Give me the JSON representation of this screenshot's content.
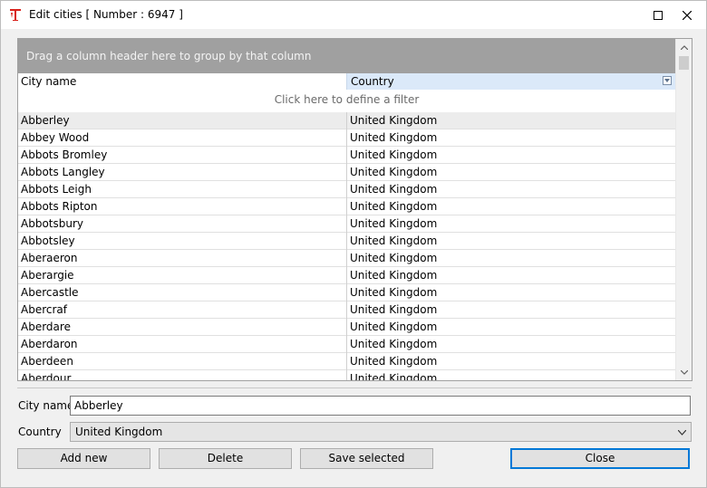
{
  "window": {
    "title": "Edit cities [ Number : 6947 ]"
  },
  "grid": {
    "group_hint": "Drag a column header here to group by that column",
    "columns": [
      "City name",
      "Country"
    ],
    "filter_hint": "Click here to define a filter",
    "rows": [
      {
        "city": "Abberley",
        "country": "United Kingdom"
      },
      {
        "city": "Abbey Wood",
        "country": "United Kingdom"
      },
      {
        "city": "Abbots Bromley",
        "country": "United Kingdom"
      },
      {
        "city": "Abbots Langley",
        "country": "United Kingdom"
      },
      {
        "city": "Abbots Leigh",
        "country": "United Kingdom"
      },
      {
        "city": "Abbots Ripton",
        "country": "United Kingdom"
      },
      {
        "city": "Abbotsbury",
        "country": "United Kingdom"
      },
      {
        "city": "Abbotsley",
        "country": "United Kingdom"
      },
      {
        "city": "Aberaeron",
        "country": "United Kingdom"
      },
      {
        "city": "Aberargie",
        "country": "United Kingdom"
      },
      {
        "city": "Abercastle",
        "country": "United Kingdom"
      },
      {
        "city": "Abercraf",
        "country": "United Kingdom"
      },
      {
        "city": "Aberdare",
        "country": "United Kingdom"
      },
      {
        "city": "Aberdaron",
        "country": "United Kingdom"
      },
      {
        "city": "Aberdeen",
        "country": "United Kingdom"
      },
      {
        "city": "Aberdour",
        "country": "United Kingdom"
      }
    ]
  },
  "form": {
    "city_label": "City name",
    "city_value": "Abberley",
    "country_label": "Country",
    "country_value": "United Kingdom"
  },
  "buttons": {
    "add_new": "Add new",
    "delete": "Delete",
    "save_selected": "Save selected",
    "close": "Close"
  },
  "colors": {
    "accent": "#0078d7",
    "group_panel": "#a0a0a0",
    "sorted_header": "#dbe9f9"
  }
}
